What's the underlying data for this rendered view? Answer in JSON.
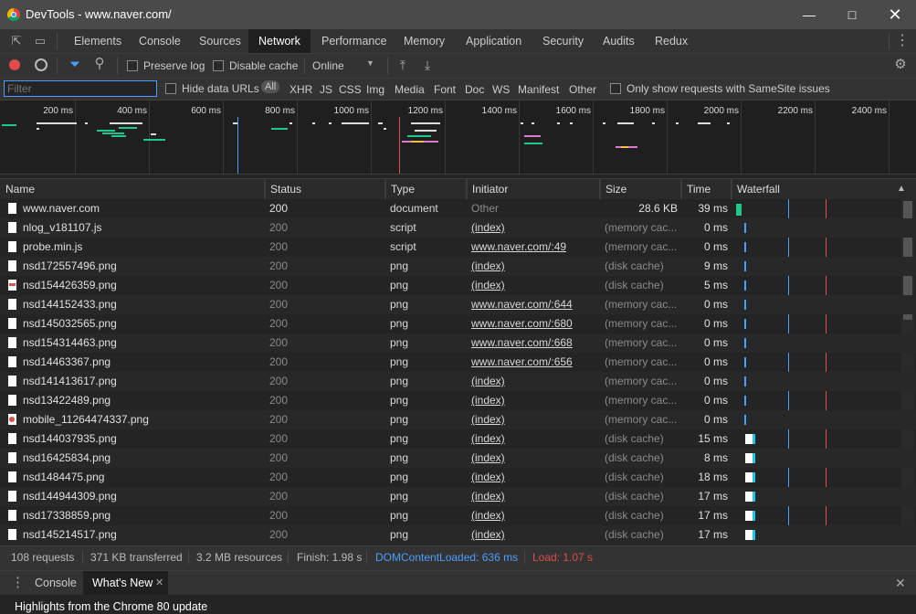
{
  "window": {
    "title": "DevTools - www.naver.com/"
  },
  "panel_tabs": [
    "Elements",
    "Console",
    "Sources",
    "Network",
    "Performance",
    "Memory",
    "Application",
    "Security",
    "Audits",
    "Redux"
  ],
  "active_tab": "Network",
  "toolbar": {
    "preserve_log": "Preserve log",
    "disable_cache": "Disable cache",
    "throttle": "Online"
  },
  "filterbar": {
    "placeholder": "Filter",
    "hide_data_urls": "Hide data URLs",
    "types": [
      "All",
      "XHR",
      "JS",
      "CSS",
      "Img",
      "Media",
      "Font",
      "Doc",
      "WS",
      "Manifest",
      "Other"
    ],
    "samesite": "Only show requests with SameSite issues"
  },
  "timeline": {
    "ticks": [
      "200 ms",
      "400 ms",
      "600 ms",
      "800 ms",
      "1000 ms",
      "1200 ms",
      "1400 ms",
      "1600 ms",
      "1800 ms",
      "2000 ms",
      "2200 ms",
      "2400 ms"
    ]
  },
  "columns": {
    "name": "Name",
    "status": "Status",
    "type": "Type",
    "initiator": "Initiator",
    "size": "Size",
    "time": "Time",
    "waterfall": "Waterfall"
  },
  "requests": [
    {
      "name": "www.naver.com",
      "status": "200",
      "type": "document",
      "initiator": "Other",
      "size": "28.6 KB",
      "time": "39 ms",
      "icon": "doc"
    },
    {
      "name": "nlog_v181107.js",
      "status": "200",
      "type": "script",
      "initiator": "(index)",
      "size": "(memory cac...",
      "time": "0 ms",
      "icon": "doc"
    },
    {
      "name": "probe.min.js",
      "status": "200",
      "type": "script",
      "initiator": "www.naver.com/:49",
      "size": "(memory cac...",
      "time": "0 ms",
      "icon": "doc"
    },
    {
      "name": "nsd172557496.png",
      "status": "200",
      "type": "png",
      "initiator": "(index)",
      "size": "(disk cache)",
      "time": "9 ms",
      "icon": "img"
    },
    {
      "name": "nsd154426359.png",
      "status": "200",
      "type": "png",
      "initiator": "(index)",
      "size": "(disk cache)",
      "time": "5 ms",
      "icon": "img-red"
    },
    {
      "name": "nsd144152433.png",
      "status": "200",
      "type": "png",
      "initiator": "www.naver.com/:644",
      "size": "(memory cac...",
      "time": "0 ms",
      "icon": "img"
    },
    {
      "name": "nsd145032565.png",
      "status": "200",
      "type": "png",
      "initiator": "www.naver.com/:680",
      "size": "(memory cac...",
      "time": "0 ms",
      "icon": "img"
    },
    {
      "name": "nsd154314463.png",
      "status": "200",
      "type": "png",
      "initiator": "www.naver.com/:668",
      "size": "(memory cac...",
      "time": "0 ms",
      "icon": "img"
    },
    {
      "name": "nsd14463367.png",
      "status": "200",
      "type": "png",
      "initiator": "www.naver.com/:656",
      "size": "(memory cac...",
      "time": "0 ms",
      "icon": "img"
    },
    {
      "name": "nsd141413617.png",
      "status": "200",
      "type": "png",
      "initiator": "(index)",
      "size": "(memory cac...",
      "time": "0 ms",
      "icon": "img"
    },
    {
      "name": "nsd13422489.png",
      "status": "200",
      "type": "png",
      "initiator": "(index)",
      "size": "(memory cac...",
      "time": "0 ms",
      "icon": "img"
    },
    {
      "name": "mobile_11264474337.png",
      "status": "200",
      "type": "png",
      "initiator": "(index)",
      "size": "(memory cac...",
      "time": "0 ms",
      "icon": "img-redcircle"
    },
    {
      "name": "nsd144037935.png",
      "status": "200",
      "type": "png",
      "initiator": "(index)",
      "size": "(disk cache)",
      "time": "15 ms",
      "icon": "img"
    },
    {
      "name": "nsd16425834.png",
      "status": "200",
      "type": "png",
      "initiator": "(index)",
      "size": "(disk cache)",
      "time": "8 ms",
      "icon": "img"
    },
    {
      "name": "nsd1484475.png",
      "status": "200",
      "type": "png",
      "initiator": "(index)",
      "size": "(disk cache)",
      "time": "18 ms",
      "icon": "img"
    },
    {
      "name": "nsd144944309.png",
      "status": "200",
      "type": "png",
      "initiator": "(index)",
      "size": "(disk cache)",
      "time": "17 ms",
      "icon": "img"
    },
    {
      "name": "nsd17338859.png",
      "status": "200",
      "type": "png",
      "initiator": "(index)",
      "size": "(disk cache)",
      "time": "17 ms",
      "icon": "img"
    },
    {
      "name": "nsd145214517.png",
      "status": "200",
      "type": "png",
      "initiator": "(index)",
      "size": "(disk cache)",
      "time": "17 ms",
      "icon": "img"
    }
  ],
  "status": {
    "requests": "108 requests",
    "transferred": "371 KB transferred",
    "resources": "3.2 MB resources",
    "finish": "Finish: 1.98 s",
    "dcl": "DOMContentLoaded: 636 ms",
    "load": "Load: 1.07 s"
  },
  "drawer": {
    "tabs": [
      "Console",
      "What's New"
    ],
    "active": "What's New",
    "highlights": "Highlights from the Chrome 80 update"
  },
  "colors": {
    "dcl": "#4a9eff",
    "load": "#e04b4b",
    "accent": "#4a9eff",
    "record": "#e04b4b"
  }
}
